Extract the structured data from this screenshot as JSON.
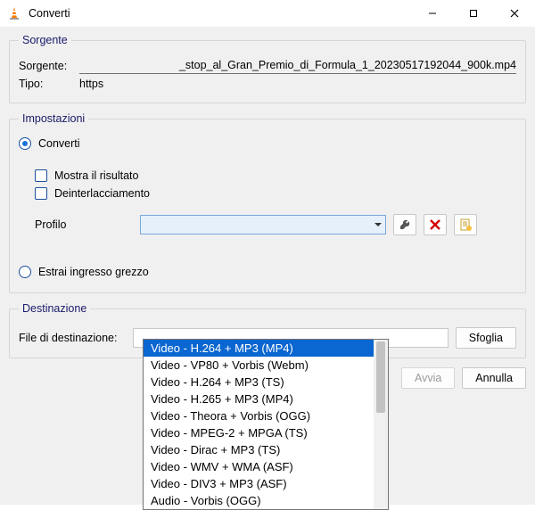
{
  "window": {
    "title": "Converti"
  },
  "source": {
    "legend": "Sorgente",
    "source_label": "Sorgente:",
    "source_value": "_stop_al_Gran_Premio_di_Formula_1_20230517192044_900k.mp4",
    "type_label": "Tipo:",
    "type_value": "https"
  },
  "settings": {
    "legend": "Impostazioni",
    "convert_label": "Converti",
    "show_result_label": "Mostra il risultato",
    "deinterlace_label": "Deinterlacciamento",
    "profile_label": "Profilo",
    "dump_raw_label": "Estrai ingresso grezzo",
    "options": [
      "Video - H.264 + MP3 (MP4)",
      "Video - VP80 + Vorbis (Webm)",
      "Video - H.264 + MP3 (TS)",
      "Video - H.265 + MP3 (MP4)",
      "Video - Theora + Vorbis (OGG)",
      "Video - MPEG-2 + MPGA (TS)",
      "Video - Dirac + MP3 (TS)",
      "Video - WMV + WMA (ASF)",
      "Video - DIV3 + MP3 (ASF)",
      "Audio - Vorbis (OGG)"
    ],
    "icons": {
      "wrench": "wrench-icon",
      "delete": "delete-icon",
      "new": "new-profile-icon"
    }
  },
  "destination": {
    "legend": "Destinazione",
    "file_label": "File di destinazione:",
    "browse_label": "Sfoglia"
  },
  "footer": {
    "start_label": "Avvia",
    "cancel_label": "Annulla"
  }
}
